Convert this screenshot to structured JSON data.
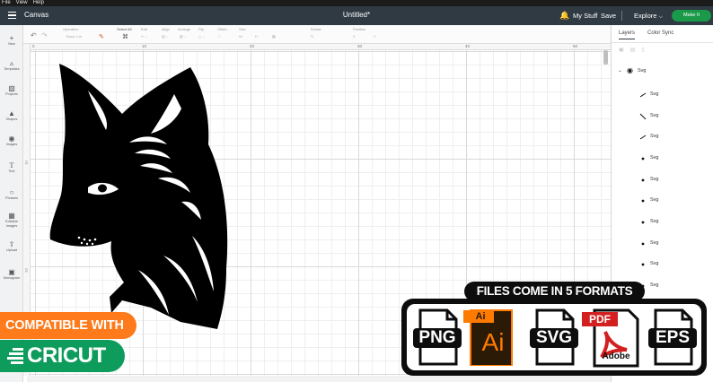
{
  "os_menu": {
    "file": "File",
    "view": "View",
    "help": "Help"
  },
  "header": {
    "app_name": "Canvas",
    "doc_title": "Untitled*",
    "my_stuff": "My Stuff",
    "save": "Save",
    "explore": "Explore",
    "make_it": "Make It"
  },
  "rail": [
    {
      "label": "New",
      "icon": "plus-icon"
    },
    {
      "label": "Templates",
      "icon": "shirt-icon"
    },
    {
      "label": "Projects",
      "icon": "projects-icon"
    },
    {
      "label": "Shapes",
      "icon": "shapes-icon"
    },
    {
      "label": "Images",
      "icon": "bulb-icon"
    },
    {
      "label": "Text",
      "icon": "text-icon"
    },
    {
      "label": "Phrases",
      "icon": "chat-icon"
    },
    {
      "label": "Editable Images",
      "icon": "edit-image-icon"
    },
    {
      "label": "Upload",
      "icon": "upload-icon"
    },
    {
      "label": "Monogram",
      "icon": "monogram-icon"
    }
  ],
  "toolbar": {
    "operation_label": "Operation",
    "operation_value": "Basic Cut",
    "select_all": "Select All",
    "edit": "Edit",
    "align": "Align",
    "arrange": "Arrange",
    "flip": "Flip",
    "offset": "Offset",
    "size": "Size",
    "rotate": "Rotate",
    "position": "Position",
    "w": "W",
    "h": "H",
    "x": "X",
    "y": "Y"
  },
  "ruler": {
    "top": [
      "0",
      "10",
      "20",
      "30",
      "40",
      "50"
    ],
    "left": [
      "10",
      "20"
    ]
  },
  "panel": {
    "tab_layers": "Layers",
    "tab_color_sync": "Color Sync",
    "group_label": "Svg",
    "layers": [
      "Svg",
      "Svg",
      "Svg",
      "Svg",
      "Svg",
      "Svg",
      "Svg",
      "Svg",
      "Svg",
      "Svg"
    ]
  },
  "promo": {
    "compatible": "COMPATIBLE WITH",
    "cricut": "CRICUT",
    "formats_title": "FILES COME IN 5 FORMATS",
    "formats": [
      "PNG",
      "Ai",
      "SVG",
      "PDF",
      "EPS"
    ],
    "ai_tab": "Ai",
    "pdf_tab": "PDF",
    "adobe": "Adobe"
  },
  "colors": {
    "header_bg": "#2f3a43",
    "make_it": "#1a9a48",
    "compat_orange": "#ff7a1a",
    "cricut_green": "#0e9c5c",
    "ai_orange": "#ff7b00",
    "ai_bg": "#2b1a06",
    "pdf_red": "#d31f1f"
  }
}
